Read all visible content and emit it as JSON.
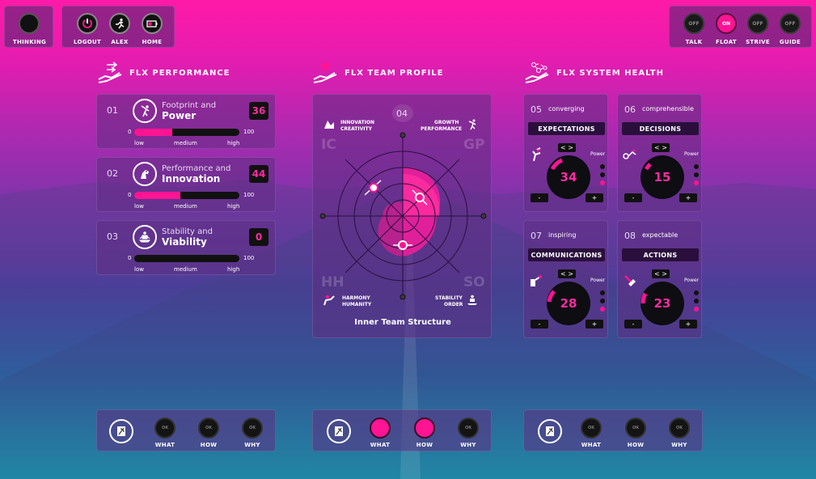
{
  "topbar": {
    "left_group": [
      {
        "label": "THINKING"
      }
    ],
    "mid_group": [
      {
        "label": "LOGOUT",
        "icon": "power-icon"
      },
      {
        "label": "ALEX",
        "icon": "runner-icon"
      },
      {
        "label": "HOME",
        "icon": "battery-icon"
      }
    ],
    "toggles": [
      {
        "label": "TALK",
        "state": "OFF"
      },
      {
        "label": "FLOAT",
        "state": "ON"
      },
      {
        "label": "STRIVE",
        "state": "OFF"
      },
      {
        "label": "GUIDE",
        "state": "OFF"
      }
    ]
  },
  "performance": {
    "title": "FLX PERFORMANCE",
    "rows": [
      {
        "num": "01",
        "sub": "Footprint and",
        "main": "Power",
        "score": "36",
        "fill": 0.36
      },
      {
        "num": "02",
        "sub": "Performance and",
        "main": "Innovation",
        "score": "44",
        "fill": 0.44
      },
      {
        "num": "03",
        "sub": "Stability and",
        "main": "Viability",
        "score": "0",
        "fill": 0.0
      }
    ],
    "scale_min": "0",
    "scale_max": "100",
    "low": "low",
    "medium": "medium",
    "high": "high"
  },
  "team": {
    "title": "FLX TEAM PROFILE",
    "num": "04",
    "q_ic": "IC",
    "q_gp": "GP",
    "q_hh": "HH",
    "q_so": "SO",
    "innovation": "INNOVATION",
    "creativity": "CREATIVITY",
    "growth": "GROWTH",
    "performance": "PERFORMANCE",
    "harmony": "HARMONY",
    "humanity": "HUMANITY",
    "stability": "STABILITY",
    "order": "ORDER",
    "caption": "Inner Team Structure"
  },
  "health": {
    "title": "FLX SYSTEM HEALTH",
    "power_label": "Power",
    "cards": [
      {
        "num": "05",
        "word": "converging",
        "label": "EXPECTATIONS",
        "value": "34"
      },
      {
        "num": "06",
        "word": "comprehensible",
        "label": "DECISIONS",
        "value": "15"
      },
      {
        "num": "07",
        "word": "inspiring",
        "label": "COMMUNICATIONS",
        "value": "28"
      },
      {
        "num": "08",
        "word": "expectable",
        "label": "ACTIONS",
        "value": "23"
      }
    ],
    "minus": "-",
    "plus": "+",
    "arrows": "< >"
  },
  "bottom": {
    "ok": "OK",
    "what": "WHAT",
    "how": "HOW",
    "why": "WHY"
  }
}
